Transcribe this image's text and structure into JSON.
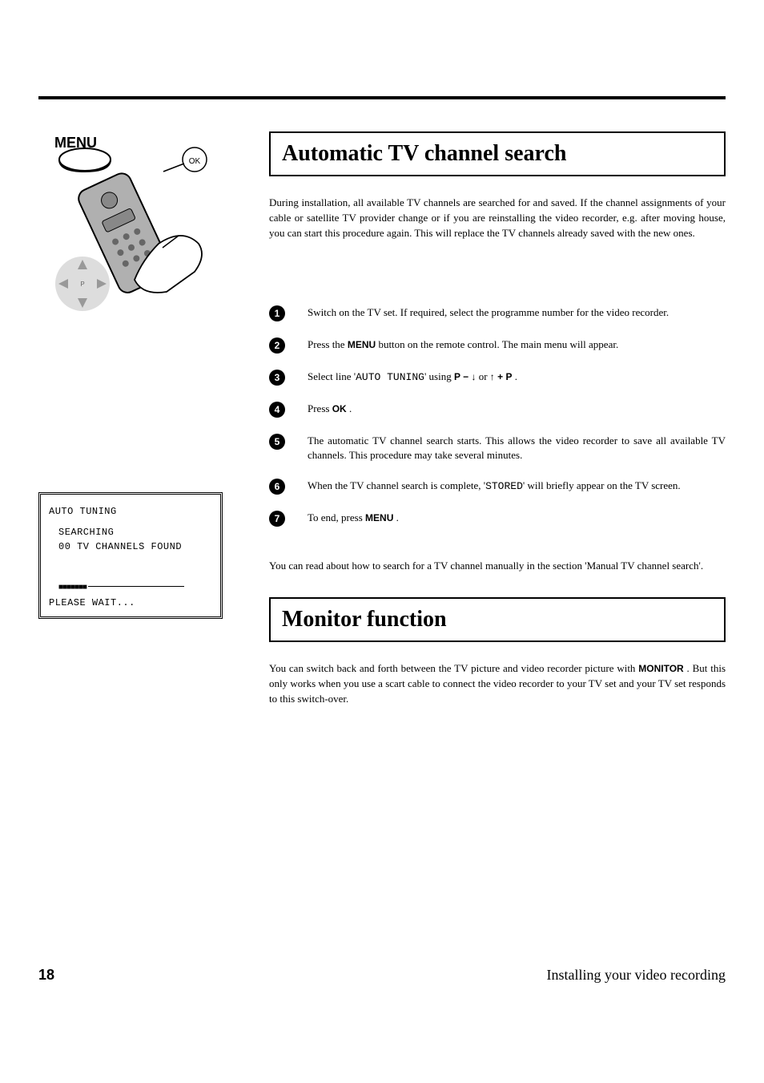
{
  "illustration": {
    "menu_label": "MENU",
    "ok_label": "OK"
  },
  "osd": {
    "title": "AUTO TUNING",
    "status": "SEARCHING",
    "found": "00 TV CHANNELS FOUND",
    "blocks": "■■■■■■■",
    "wait": "PLEASE WAIT..."
  },
  "section1": {
    "title": "Automatic TV channel search",
    "intro": "During installation, all available TV channels are searched for and saved. If the channel assignments of your cable or satellite TV provider change or if you are reinstalling the video recorder, e.g. after moving house, you can start this procedure again. This will replace the TV channels already saved with the new ones.",
    "steps": [
      {
        "n": "1",
        "pre": "Switch on the TV set. If required, select the programme number for the video recorder."
      },
      {
        "n": "2",
        "pre": "Press the ",
        "btn": "MENU",
        "post": " button on the remote control. The main menu will appear."
      },
      {
        "n": "3",
        "pre": "Select line '",
        "mono": "AUTO TUNING",
        "mid": "' using ",
        "keys": true,
        "post2": " ."
      },
      {
        "n": "4",
        "pre": "Press ",
        "btn": "OK",
        "post": " ."
      },
      {
        "n": "5",
        "pre": "The automatic TV channel search starts. This allows the video recorder to save all available TV channels. This procedure may take several minutes."
      },
      {
        "n": "6",
        "pre": "When the TV channel search is complete, '",
        "mono": "STORED",
        "post": "' will briefly appear on the TV screen."
      },
      {
        "n": "7",
        "pre": "To end, press ",
        "btn": "MENU",
        "post": " ."
      }
    ],
    "footnote": "You can read about how to search for a TV channel manually in the section 'Manual TV channel search'."
  },
  "section2": {
    "title": "Monitor function",
    "intro_pre": "You can switch back and forth between the TV picture and video recorder picture with ",
    "btn": "MONITOR",
    "intro_post": " . But this only works when you use a scart cable to connect the video recorder to your TV set and your TV set responds to this switch-over."
  },
  "footer": {
    "page": "18",
    "text": "Installing your video recording"
  },
  "keys": {
    "p_minus_down": "P − ↓",
    "or": " or ",
    "up_plus_p": "↑ + P"
  }
}
